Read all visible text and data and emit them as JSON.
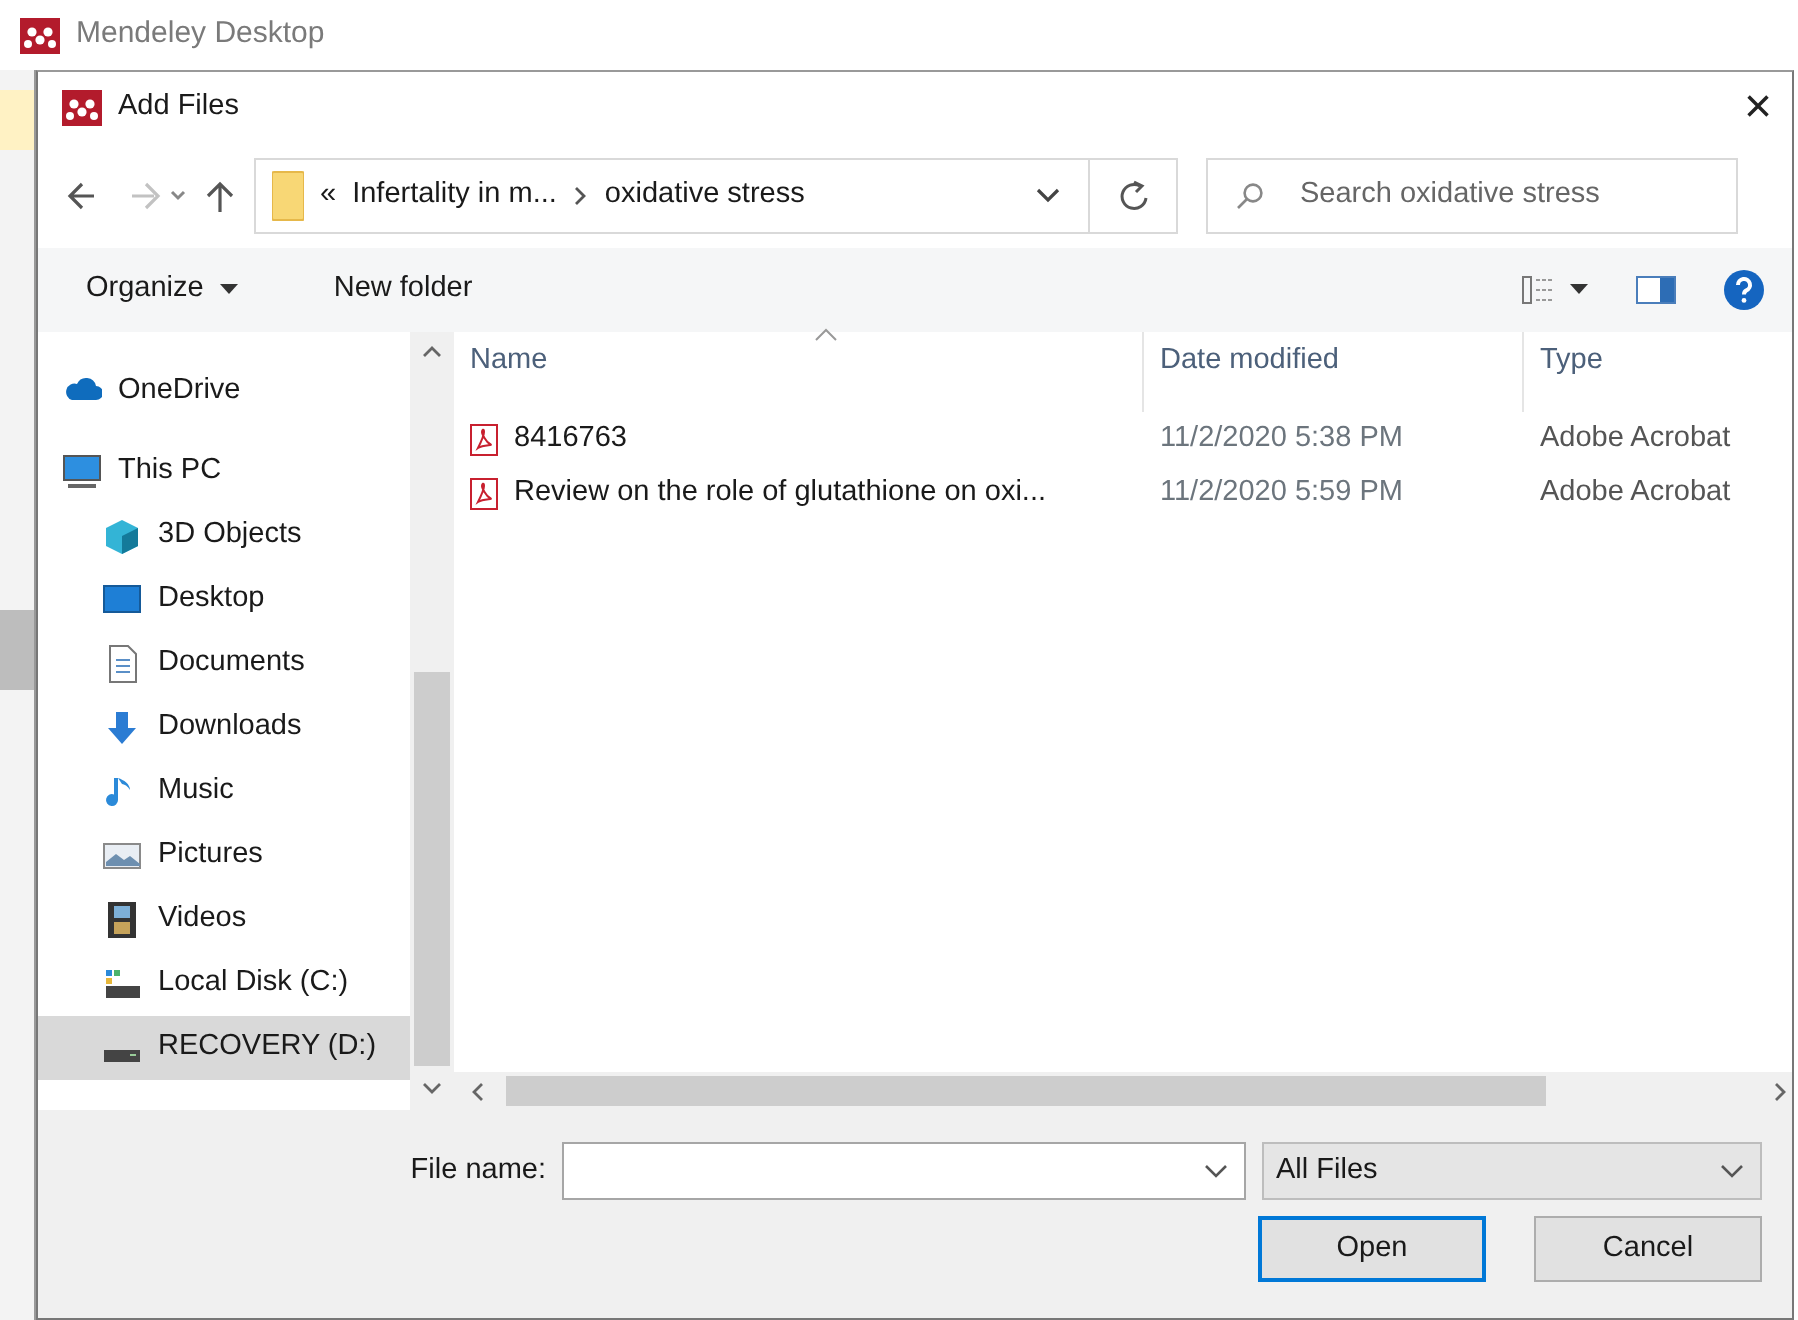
{
  "app": {
    "title": "Mendeley Desktop"
  },
  "dialog": {
    "title": "Add Files",
    "close": "×"
  },
  "address": {
    "overflow": "«",
    "segments": [
      "Infertality in m...",
      "oxidative stress"
    ]
  },
  "search": {
    "placeholder": "Search oxidative stress"
  },
  "toolbar": [
    {
      "label": "Organize",
      "kind": "menu"
    },
    {
      "label": "New folder",
      "kind": "plain"
    }
  ],
  "nav": [
    {
      "label": "OneDrive",
      "kind": "cloud",
      "selected": false
    },
    {
      "label": "This PC",
      "kind": "computer",
      "selected": false,
      "children": [
        {
          "label": "3D Objects",
          "kind": "cube",
          "selected": false
        },
        {
          "label": "Desktop",
          "kind": "desktop",
          "selected": false
        },
        {
          "label": "Documents",
          "kind": "document",
          "selected": false
        },
        {
          "label": "Downloads",
          "kind": "download",
          "selected": false
        },
        {
          "label": "Music",
          "kind": "music",
          "selected": false
        },
        {
          "label": "Pictures",
          "kind": "picture",
          "selected": false
        },
        {
          "label": "Videos",
          "kind": "video",
          "selected": false
        },
        {
          "label": "Local Disk (C:)",
          "kind": "system-drive",
          "selected": false
        },
        {
          "label": "RECOVERY (D:)",
          "kind": "drive",
          "selected": true
        }
      ]
    }
  ],
  "table": {
    "columns": [
      {
        "label": "Name",
        "sorted": true
      },
      {
        "label": "Date modified",
        "sorted": false
      },
      {
        "label": "Type",
        "sorted": false
      }
    ],
    "rows": [
      {
        "name": "8416763",
        "date": "11/2/2020 5:38 PM",
        "type": "Adobe Acrobat"
      },
      {
        "name": "Review on the role of glutathione on oxi...",
        "date": "11/2/2020 5:59 PM",
        "type": "Adobe Acrobat"
      }
    ]
  },
  "file_name": {
    "label": "File name:"
  },
  "filter": {
    "value": "All Files"
  },
  "buttons": [
    {
      "label": "Open",
      "default": true
    },
    {
      "label": "Cancel",
      "default": false
    }
  ]
}
